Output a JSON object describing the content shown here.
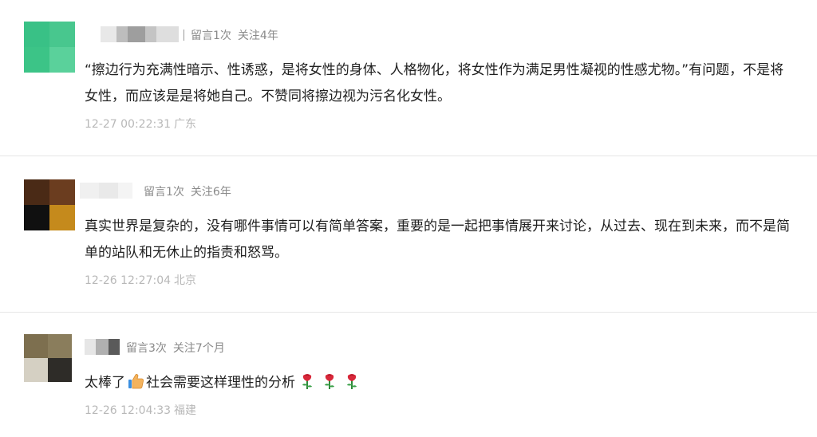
{
  "comments": [
    {
      "meta_comments": "留言1次",
      "meta_follow": "关注4年",
      "text": "“擦边行为充满性暗示、性诱惑，是将女性的身体、人格物化，将女性作为满足男性凝视的性感尤物。”有问题，不是将女性，而应该是是将她自己。不赞同将擦边视为污名化女性。",
      "time": "12-27 00:22:31",
      "location": "广东"
    },
    {
      "meta_comments": "留言1次",
      "meta_follow": "关注6年",
      "text": "真实世界是复杂的，没有哪件事情可以有简单答案，重要的是一起把事情展开来讨论，从过去、现在到未来，而不是简单的站队和无休止的指责和怒骂。",
      "time": "12-26 12:27:04",
      "location": "北京"
    },
    {
      "meta_comments": "留言3次",
      "meta_follow": "关注7个月",
      "text_before": "太棒了",
      "text_after": "社会需要这样理性的分析",
      "emoji_thumb": "thumbs-up-icon",
      "emoji_rose": "rose-icon",
      "time": "12-26 12:04:33",
      "location": "福建"
    }
  ]
}
